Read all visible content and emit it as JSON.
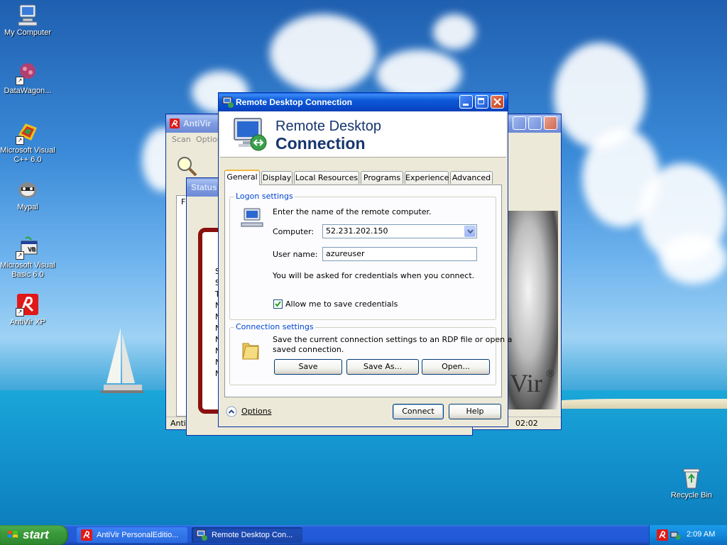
{
  "desktop": {
    "icons": [
      {
        "label": "My Computer",
        "icon": "my-computer-icon"
      },
      {
        "label": "DataWagon...",
        "icon": "datawagon-icon"
      },
      {
        "label": "Microsoft Visual C++ 6.0",
        "icon": "visual-cpp-icon"
      },
      {
        "label": "Mypal",
        "icon": "mypal-icon"
      },
      {
        "label": "Microsoft Visual Basic 6.0",
        "icon": "visual-basic-icon"
      },
      {
        "label": "AntiVir XP",
        "icon": "antivir-icon"
      },
      {
        "label": "Recycle Bin",
        "icon": "recycle-bin-icon"
      }
    ]
  },
  "antivir_window": {
    "title": "AntiVir",
    "menu": [
      "Scan",
      "Option"
    ],
    "left_letter": "F",
    "status_left": "AntiVi",
    "status_time": "02:02",
    "logo_text": "Vir",
    "logo_reg": "®"
  },
  "status_window": {
    "title": "Status",
    "list_letters": [
      "S",
      "S",
      "T",
      "N",
      "N",
      "N",
      "N",
      "N",
      "N",
      "N"
    ]
  },
  "rdc": {
    "title": "Remote Desktop Connection",
    "header_line1": "Remote Desktop",
    "header_line2": "Connection",
    "tabs": [
      "General",
      "Display",
      "Local Resources",
      "Programs",
      "Experience",
      "Advanced"
    ],
    "logon": {
      "label": "Logon settings",
      "intro": "Enter the name of the remote computer.",
      "computer_label": "Computer:",
      "computer_value": "52.231.202.150",
      "username_label": "User name:",
      "username_value": "azureuser",
      "note": "You will be asked for credentials when you connect.",
      "save_credentials": "Allow me to save credentials",
      "save_credentials_checked": true
    },
    "connection": {
      "label": "Connection settings",
      "text_line1": "Save the current connection settings to an RDP file or open a",
      "text_line2": "saved connection.",
      "save": "Save",
      "save_as": "Save As...",
      "open": "Open..."
    },
    "options": "Options",
    "connect": "Connect",
    "help": "Help"
  },
  "taskbar": {
    "start": "start",
    "buttons": [
      "AntiVir PersonalEditio...",
      "Remote Desktop Con..."
    ],
    "clock": "2:09 AM"
  },
  "colors": {
    "title_active": "#0845c4",
    "dialog_bg": "#ece9d8",
    "start_green": "#3b9a3b",
    "group_label": "#0046d5"
  }
}
